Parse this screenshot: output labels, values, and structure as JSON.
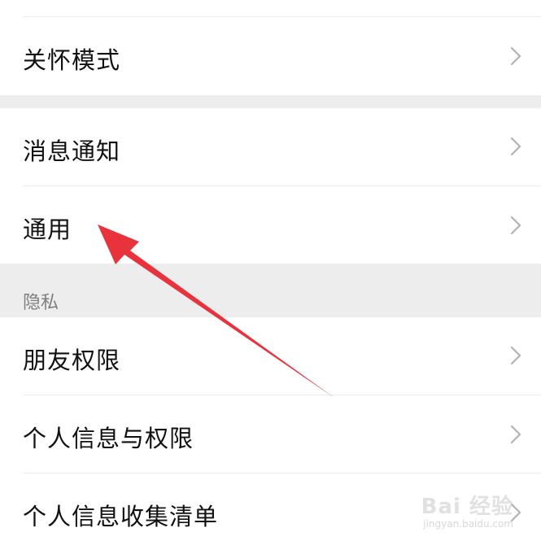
{
  "settings": {
    "items_top": [
      {
        "label": "关怀模式"
      }
    ],
    "items_group2": [
      {
        "label": "消息通知"
      },
      {
        "label": "通用"
      }
    ],
    "privacy_section": {
      "title": "隐私",
      "items": [
        {
          "label": "朋友权限"
        },
        {
          "label": "个人信息与权限"
        },
        {
          "label": "个人信息收集清单"
        }
      ]
    }
  },
  "annotation": {
    "arrow_color": "#e8323c",
    "points_to": "通用"
  },
  "watermark": {
    "main": "Bai 经验",
    "sub": "jingyan.baidu.com"
  },
  "icons": {
    "chevron": "chevron-right-icon"
  }
}
